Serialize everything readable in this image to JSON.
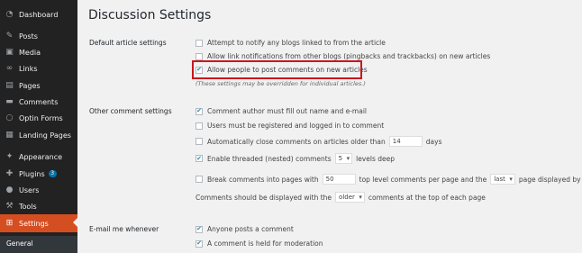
{
  "sidebar": {
    "items": [
      {
        "label": "Dashboard",
        "icon": "dashboard-icon"
      },
      {
        "label": "Posts",
        "icon": "pin-icon"
      },
      {
        "label": "Media",
        "icon": "media-icon"
      },
      {
        "label": "Links",
        "icon": "links-icon"
      },
      {
        "label": "Pages",
        "icon": "pages-icon"
      },
      {
        "label": "Comments",
        "icon": "comments-icon"
      },
      {
        "label": "Optin Forms",
        "icon": "optin-icon"
      },
      {
        "label": "Landing Pages",
        "icon": "landing-pages-icon"
      },
      {
        "label": "Appearance",
        "icon": "appearance-icon"
      },
      {
        "label": "Plugins",
        "icon": "plugins-icon",
        "badge": "3"
      },
      {
        "label": "Users",
        "icon": "users-icon"
      },
      {
        "label": "Tools",
        "icon": "tools-icon"
      },
      {
        "label": "Settings",
        "icon": "settings-icon",
        "active": true
      }
    ],
    "submenu_first": "General"
  },
  "page": {
    "title": "Discussion Settings"
  },
  "default_article": {
    "label": "Default article settings",
    "options": [
      {
        "label": "Attempt to notify any blogs linked to from the article",
        "checked": false
      },
      {
        "label": "Allow link notifications from other blogs (pingbacks and trackbacks) on new articles",
        "checked": false
      },
      {
        "label": "Allow people to post comments on new articles",
        "checked": true
      }
    ],
    "note": "(These settings may be overridden for individual articles.)"
  },
  "other_comment": {
    "label": "Other comment settings",
    "author_fill": "Comment author must fill out name and e-mail",
    "registered": "Users must be registered and logged in to comment",
    "auto_close_pre": "Automatically close comments on articles older than",
    "auto_close_days": "14",
    "auto_close_post": "days",
    "threaded_pre": "Enable threaded (nested) comments",
    "threaded_levels": "5",
    "threaded_post": "levels deep",
    "break_pre": "Break comments into pages with",
    "break_count": "50",
    "break_mid": "top level comments per page and the",
    "break_page": "last",
    "break_post": "page displayed by default",
    "order_pre": "Comments should be displayed with the",
    "order_value": "older",
    "order_post": "comments at the top of each page",
    "checked": {
      "author_fill": true,
      "registered": false,
      "auto_close": false,
      "threaded": true,
      "break": false
    }
  },
  "email_me": {
    "label": "E-mail me whenever",
    "options": [
      {
        "label": "Anyone posts a comment",
        "checked": true
      },
      {
        "label": "A comment is held for moderation",
        "checked": true
      }
    ]
  },
  "colors": {
    "sidebar_bg": "#222222",
    "active_bg": "#d54e21",
    "highlight_border": "#c9171f",
    "checkmark": "#1e8cbe"
  }
}
